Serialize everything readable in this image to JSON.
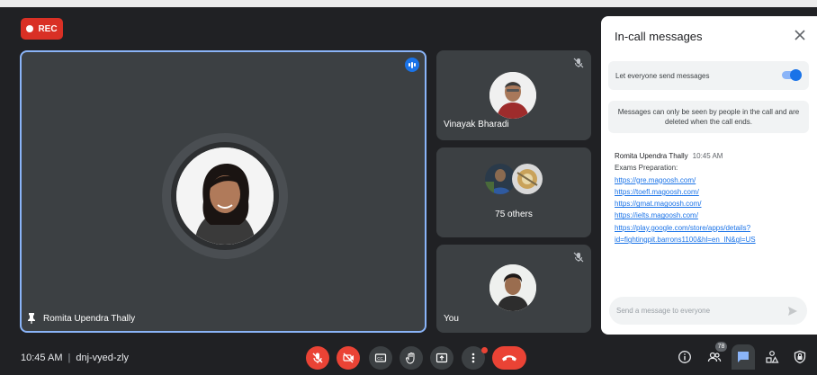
{
  "rec": {
    "label": "REC"
  },
  "main_tile": {
    "name": "Romita Upendra Thally"
  },
  "tiles": [
    {
      "name": "Vinayak Bharadi"
    },
    {
      "name": "75 others"
    },
    {
      "name": "You"
    }
  ],
  "chat_panel": {
    "title": "In-call messages",
    "toggle_label": "Let everyone send messages",
    "toggle_on": true,
    "notice": "Messages can only be seen by people in the call and are deleted when the call ends.",
    "message": {
      "sender": "Romita Upendra Thally",
      "time": "10:45 AM",
      "text": "Exams Preparation:",
      "links": [
        "https://gre.magoosh.com/",
        "https://toefl.magoosh.com/",
        "https://gmat.magoosh.com/",
        "https://ielts.magoosh.com/",
        "https://play.google.com/store/apps/details?",
        "id=fightingpit.barrons1100&hl=en_IN&gl=US"
      ]
    },
    "input_placeholder": "Send a message to everyone"
  },
  "bottom_bar": {
    "time": "10:45 AM",
    "separator": "|",
    "meeting_code": "dnj-vyed-zly",
    "participants_count": "78"
  },
  "colors": {
    "background": "#202124",
    "tile": "#3c4043",
    "accent_blue": "#1a73e8",
    "active_border": "#8ab4f8",
    "red": "#ea4335"
  },
  "icons": {
    "controls": [
      "mic-off-icon",
      "camera-off-icon",
      "captions-icon",
      "raise-hand-icon",
      "present-icon",
      "more-options-icon",
      "end-call-icon"
    ],
    "right": [
      "info-icon",
      "people-icon",
      "chat-icon",
      "activities-icon",
      "host-controls-icon"
    ]
  }
}
